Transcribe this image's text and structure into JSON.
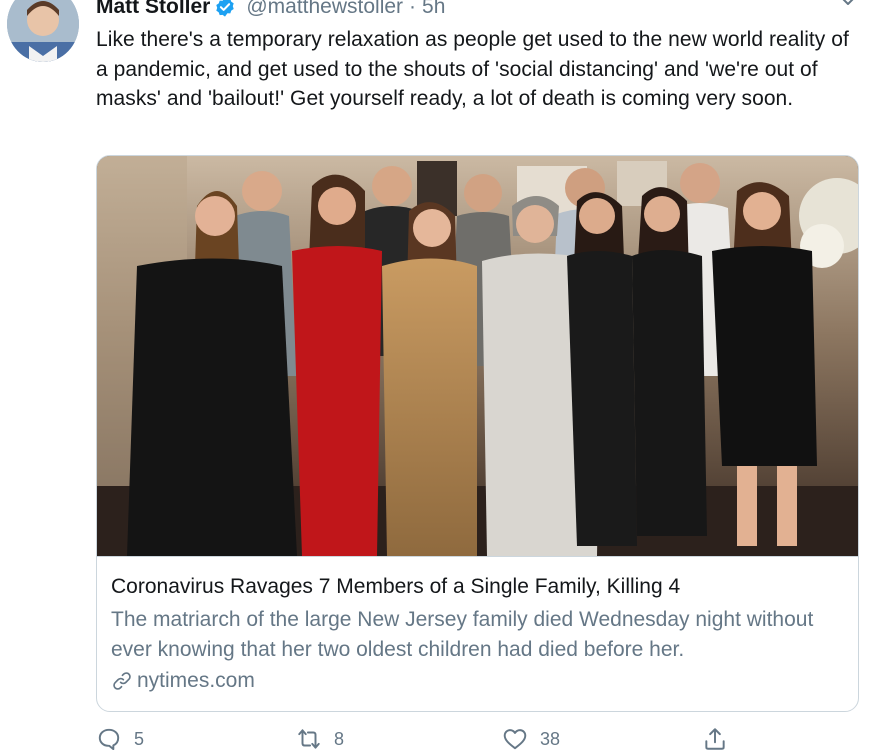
{
  "tweet": {
    "author_name": "Matt Stoller",
    "author_handle": "@matthewstoller",
    "separator": "·",
    "time": "5h",
    "verified": true,
    "text": "Like there's a temporary relaxation as people get used to the new world reality of a pandemic, and get used to the shouts of 'social distancing' and 'we're out of masks' and 'bailout!' Get yourself ready, a lot of death is coming very soon."
  },
  "card": {
    "title": "Coronavirus Ravages 7 Members of a Single Family, Killing 4",
    "description": "The matriarch of the large New Jersey family died Wednesday night without ever knowing that her two oldest children had died before her.",
    "domain": "nytimes.com"
  },
  "actions": {
    "reply_count": "5",
    "retweet_count": "8",
    "like_count": "38"
  },
  "icons": {
    "verified": "verified-badge-icon",
    "caret": "chevron-down-icon",
    "link": "link-icon",
    "reply": "reply-icon",
    "retweet": "retweet-icon",
    "like": "heart-icon",
    "share": "share-icon"
  },
  "colors": {
    "text_primary": "#14171a",
    "text_secondary": "#657786",
    "verified_blue": "#1da1f2",
    "border": "#ccd6dd"
  }
}
